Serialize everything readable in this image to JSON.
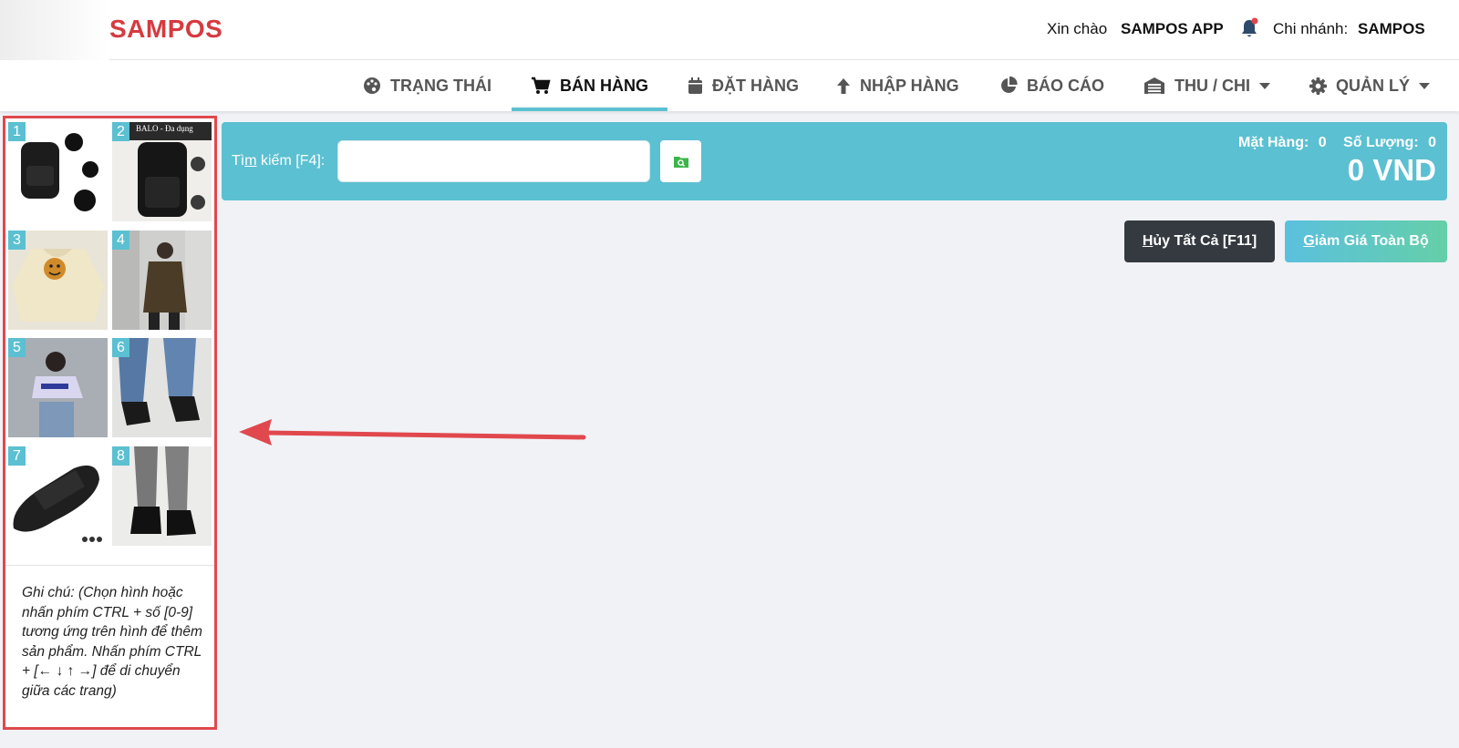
{
  "header": {
    "logo": "SAMPOS",
    "greeting_label": "Xin chào",
    "user_name": "SAMPOS APP",
    "branch_label": "Chi nhánh:",
    "branch_name": "SAMPOS"
  },
  "nav": {
    "items": [
      {
        "label": "TRẠNG THÁI",
        "icon": "palette-icon"
      },
      {
        "label": "BÁN HÀNG",
        "icon": "cart-icon",
        "active": true
      },
      {
        "label": "ĐẶT HÀNG",
        "icon": "calendar-icon"
      },
      {
        "label": "NHẬP HÀNG",
        "icon": "arrow-up-icon"
      },
      {
        "label": "BÁO CÁO",
        "icon": "pie-chart-icon"
      },
      {
        "label": "THU / CHI",
        "icon": "warehouse-icon",
        "dropdown": true
      },
      {
        "label": "QUẢN LÝ",
        "icon": "gear-icon",
        "dropdown": true
      }
    ]
  },
  "products": [
    {
      "num": "1",
      "kind": "black backpack"
    },
    {
      "num": "2",
      "kind": "black backpack",
      "caption": "BALO - Đa dụng"
    },
    {
      "num": "3",
      "kind": "cream hoodie with smiley"
    },
    {
      "num": "4",
      "kind": "brown hoodie"
    },
    {
      "num": "5",
      "kind": "crop t-shirt"
    },
    {
      "num": "6",
      "kind": "black heeled sandals"
    },
    {
      "num": "7",
      "kind": "black slide sandal"
    },
    {
      "num": "8",
      "kind": "black loafers"
    }
  ],
  "note": "Ghi chú: (Chọn hình hoặc nhấn phím CTRL + số [0-9] tương ứng trên hình để thêm sản phẩm. Nhấn phím CTRL + [← ↓ ↑ →] để di chuyển giữa các trang)",
  "search": {
    "label_pre": "Tì",
    "label_underlined": "m",
    "label_post": " kiếm [F4]:",
    "value": "",
    "placeholder": ""
  },
  "summary": {
    "items_label": "Mặt Hàng:",
    "items_value": "0",
    "qty_label": "Số Lượng:",
    "qty_value": "0",
    "total": "0 VND"
  },
  "actions": {
    "cancel_hotkey": "H",
    "cancel_rest": "ủy Tất Cả [F11]",
    "discount_hotkey": "G",
    "discount_rest": "iảm Giá Toàn Bộ"
  },
  "colors": {
    "brand": "#d63a3f",
    "accent": "#5bc0d1",
    "annotation": "#e0484d",
    "dark_button": "#343a40"
  }
}
